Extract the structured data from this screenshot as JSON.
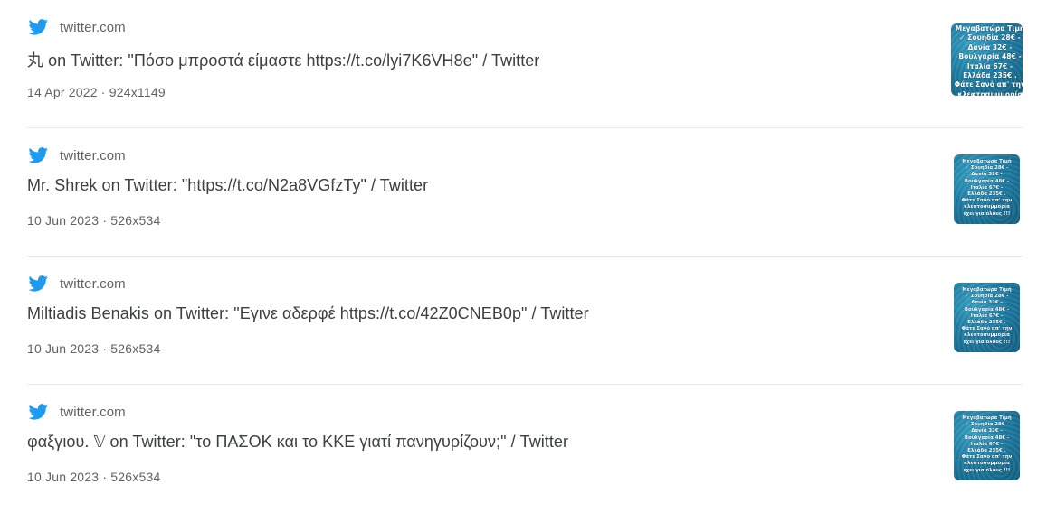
{
  "results": [
    {
      "source": "twitter.com",
      "icon": "twitter-bird-icon",
      "title": "丸 on Twitter: \"Πόσο μπροστά είμαστε https://t.co/lyi7K6VH8e\" / Twitter",
      "meta": "14 Apr 2022 · 924x1149",
      "thumb_text": "Μεγαβατώρα Τιμή\n✓ Σουηδία 28€ -\nΔανία 32€ -\nΒουλγαρία 48€ -\nΙταλία 67€ -\nΕλλάδα 235€ .\nΦάτε Σανό απ' την\nκλεφτοσυμμορία"
    },
    {
      "source": "twitter.com",
      "icon": "twitter-bird-icon",
      "title": "Mr. Shrek on Twitter: \"https://t.co/N2a8VGfzTy\" / Twitter",
      "meta": "10 Jun 2023 · 526x534",
      "thumb_text": "Μεγαβατώρα Τιμή\n✓ Σουηδία 28€ -\nΔανία 32€ -\nΒουλγαρία 48€ -\nΙταλία 67€ -\nΕλλάδα 235€ .\nΦάτε Σανό απ' την\nκλεφτοσυμμορία\nέχει για όλους !!!"
    },
    {
      "source": "twitter.com",
      "icon": "twitter-bird-icon",
      "title": "Miltiadis Benakis on Twitter: \"Εγινε αδερφέ https://t.co/42Z0CNEB0p\" / Twitter",
      "meta": "10 Jun 2023 · 526x534",
      "thumb_text": "Μεγαβατώρα Τιμή\n✓ Σουηδία 28€ -\nΔανία 32€ -\nΒουλγαρία 48€ -\nΙταλία 67€ -\nΕλλάδα 235€ .\nΦάτε Σανό απ' την\nκλεφτοσυμμορία\nέχει για όλους !!!"
    },
    {
      "source": "twitter.com",
      "icon": "twitter-bird-icon",
      "title": "φαξγιου. 𝕍 on Twitter: \"το ΠΑΣΟΚ και το ΚΚΕ γιατί πανηγυρίζουν;\" / Twitter",
      "meta": "10 Jun 2023 · 526x534",
      "thumb_text": "Μεγαβατώρα Τιμή\n✓ Σουηδία 28€ -\nΔανία 32€ -\nΒουλγαρία 48€ -\nΙταλία 67€ -\nΕλλάδα 235€ .\nΦάτε Σανό απ' την\nκλεφτοσυμμορία\nέχει για όλους !!!"
    }
  ],
  "colors": {
    "twitter_blue": "#1d9bf0",
    "title_text": "#3c4043",
    "meta_text": "#5f6368",
    "separator": "#e8eaed"
  }
}
